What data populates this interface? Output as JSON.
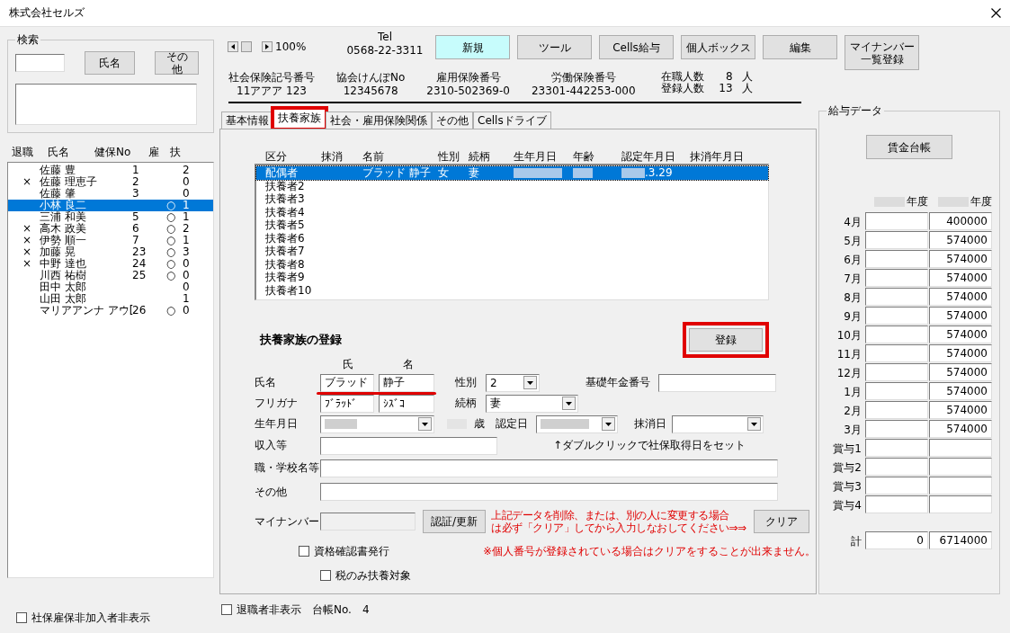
{
  "window": {
    "title": "株式会社セルズ"
  },
  "search": {
    "title": "検索",
    "buttons": [
      "氏名",
      "その他"
    ]
  },
  "employee_list": {
    "columns": [
      "退職",
      "氏名",
      "健保No",
      "雇",
      "扶"
    ],
    "rows": [
      {
        "retired": "",
        "name": "佐藤 豊",
        "no": "1",
        "emp": "",
        "dep": "2",
        "selected": false
      },
      {
        "retired": "×",
        "name": "佐藤 理恵子",
        "no": "2",
        "emp": "",
        "dep": "0",
        "selected": false
      },
      {
        "retired": "",
        "name": "佐藤 肇",
        "no": "3",
        "emp": "",
        "dep": "0",
        "selected": false
      },
      {
        "retired": "",
        "name": "小林 良二",
        "no": "",
        "emp": "○",
        "dep": "1",
        "selected": true
      },
      {
        "retired": "",
        "name": "三浦 和美",
        "no": "5",
        "emp": "○",
        "dep": "1",
        "selected": false
      },
      {
        "retired": "×",
        "name": "高木 政美",
        "no": "6",
        "emp": "○",
        "dep": "2",
        "selected": false
      },
      {
        "retired": "×",
        "name": "伊勢 順一",
        "no": "7",
        "emp": "○",
        "dep": "1",
        "selected": false
      },
      {
        "retired": "×",
        "name": "加藤 晃",
        "no": "23",
        "emp": "○",
        "dep": "3",
        "selected": false
      },
      {
        "retired": "×",
        "name": "中野 達也",
        "no": "24",
        "emp": "○",
        "dep": "0",
        "selected": false
      },
      {
        "retired": "",
        "name": "川西 祐樹",
        "no": "25",
        "emp": "○",
        "dep": "0",
        "selected": false
      },
      {
        "retired": "",
        "name": "田中 太郎",
        "no": "",
        "emp": "",
        "dep": "0",
        "selected": false
      },
      {
        "retired": "",
        "name": "山田 太郎",
        "no": "",
        "emp": "",
        "dep": "1",
        "selected": false
      },
      {
        "retired": "",
        "name": "マリアアンナ アウ[",
        "no": "26",
        "emp": "○",
        "dep": "0",
        "selected": false
      }
    ]
  },
  "hide_uninsured": {
    "label": "社保雇保非加入者非表示",
    "checked": false
  },
  "toolbar": {
    "zoom": "100%",
    "tel_label": "Tel",
    "tel": "0568-22-3311",
    "buttons": [
      {
        "label": "新規",
        "active": true
      },
      {
        "label": "ツール",
        "active": false
      },
      {
        "label": "Cells給与",
        "active": false
      },
      {
        "label": "個人ボックス",
        "active": false
      },
      {
        "label": "編集",
        "active": false
      },
      {
        "label": "マイナンバー一覧登録",
        "active": false
      }
    ]
  },
  "company_info": [
    {
      "label": "社会保険記号番号",
      "value": "11アアア 123"
    },
    {
      "label": "協会けんぽNo",
      "value": "12345678"
    },
    {
      "label": "雇用保険番号",
      "value": "2310-502369-0"
    },
    {
      "label": "労働保険番号",
      "value": "23301-442253-000"
    }
  ],
  "counts": [
    {
      "label": "在職人数",
      "value": "8",
      "unit": "人"
    },
    {
      "label": "登録人数",
      "value": "13",
      "unit": "人"
    }
  ],
  "tabs": [
    {
      "label": "基本情報",
      "selected": false,
      "highlighted": false
    },
    {
      "label": "扶養家族",
      "selected": true,
      "highlighted": true
    },
    {
      "label": "社会・雇用保険関係",
      "selected": false,
      "highlighted": false
    },
    {
      "label": "その他",
      "selected": false,
      "highlighted": false
    },
    {
      "label": "Cellsドライブ",
      "selected": false,
      "highlighted": false
    }
  ],
  "dependents_list": {
    "columns": [
      "区分",
      "抹消",
      "名前",
      "性別",
      "続柄",
      "生年月日",
      "年齢",
      "認定年月日",
      "抹消年月日"
    ],
    "rows": [
      {
        "cells": [
          {
            "text": "配偶者"
          },
          {
            "text": ""
          },
          {
            "text": "ブラッド 静子"
          },
          {
            "text": "女"
          },
          {
            "text": "妻"
          },
          {
            "text": "",
            "blurred": true
          },
          {
            "text": "",
            "blurred": true
          },
          {
            "text": ".3.29",
            "blurred": true
          },
          {
            "text": ""
          }
        ],
        "selected": true
      },
      {
        "cells": [
          {
            "text": "扶養者2"
          }
        ],
        "selected": false
      },
      {
        "cells": [
          {
            "text": "扶養者3"
          }
        ],
        "selected": false
      },
      {
        "cells": [
          {
            "text": "扶養者4"
          }
        ],
        "selected": false
      },
      {
        "cells": [
          {
            "text": "扶養者5"
          }
        ],
        "selected": false
      },
      {
        "cells": [
          {
            "text": "扶養者6"
          }
        ],
        "selected": false
      },
      {
        "cells": [
          {
            "text": "扶養者7"
          }
        ],
        "selected": false
      },
      {
        "cells": [
          {
            "text": "扶養者8"
          }
        ],
        "selected": false
      },
      {
        "cells": [
          {
            "text": "扶養者9"
          }
        ],
        "selected": false
      },
      {
        "cells": [
          {
            "text": "扶養者10"
          }
        ],
        "selected": false
      }
    ]
  },
  "form": {
    "title": "扶養家族の登録",
    "register_button": {
      "label": "登録",
      "highlighted": true
    },
    "name_headers": [
      "氏",
      "名"
    ],
    "name_label": "氏名",
    "last_name": "ブラッド",
    "first_name": "静子",
    "name_underlined": true,
    "kana_label": "フリガナ",
    "last_kana": "ﾌﾞﾗｯﾄﾞ",
    "first_kana": "ｼｽﾞｺ",
    "gender_label": "性別",
    "gender": "2",
    "relation_label": "続柄",
    "relation": "妻",
    "pension_label": "基礎年金番号",
    "birth_label": "生年月日",
    "age_unit": "歳",
    "recognized_label": "認定日",
    "removed_label": "抹消日",
    "income_label": "収入等",
    "income_hint": "↑ダブルクリックで社保取得日をセット",
    "work_label": "職・学校名等",
    "other_label": "その他",
    "mynumber_label": "マイナンバー",
    "auth_button": "認証/更新",
    "warning_lines": [
      "上記データを削除、または、別の人に変更する場合",
      "は必ず「クリア」してから入力しなおしてください⇒⇒"
    ],
    "clear_button": "クリア",
    "note": "※個人番号が登録されている場合はクリアをすることが出来ません。",
    "checkboxes": [
      {
        "label": "資格確認書発行",
        "checked": false
      },
      {
        "label": "税のみ扶養対象",
        "checked": false
      }
    ]
  },
  "hide_retired": {
    "label": "退職者非表示",
    "checked": false
  },
  "ledger": {
    "label": "台帳No.",
    "value": "4"
  },
  "salary": {
    "title": "給与データ",
    "button": "賃金台帳",
    "year_headers": [
      "年度",
      "年度"
    ],
    "rows": [
      {
        "label": "4月",
        "prev": "",
        "curr": "400000"
      },
      {
        "label": "5月",
        "prev": "",
        "curr": "574000"
      },
      {
        "label": "6月",
        "prev": "",
        "curr": "574000"
      },
      {
        "label": "7月",
        "prev": "",
        "curr": "574000"
      },
      {
        "label": "8月",
        "prev": "",
        "curr": "574000"
      },
      {
        "label": "9月",
        "prev": "",
        "curr": "574000"
      },
      {
        "label": "10月",
        "prev": "",
        "curr": "574000"
      },
      {
        "label": "11月",
        "prev": "",
        "curr": "574000"
      },
      {
        "label": "12月",
        "prev": "",
        "curr": "574000"
      },
      {
        "label": "1月",
        "prev": "",
        "curr": "574000"
      },
      {
        "label": "2月",
        "prev": "",
        "curr": "574000"
      },
      {
        "label": "3月",
        "prev": "",
        "curr": "574000"
      },
      {
        "label": "賞与1",
        "prev": "",
        "curr": ""
      },
      {
        "label": "賞与2",
        "prev": "",
        "curr": ""
      },
      {
        "label": "賞与3",
        "prev": "",
        "curr": ""
      },
      {
        "label": "賞与4",
        "prev": "",
        "curr": ""
      }
    ],
    "total": {
      "label": "計",
      "prev": "0",
      "curr": "6714000"
    }
  }
}
